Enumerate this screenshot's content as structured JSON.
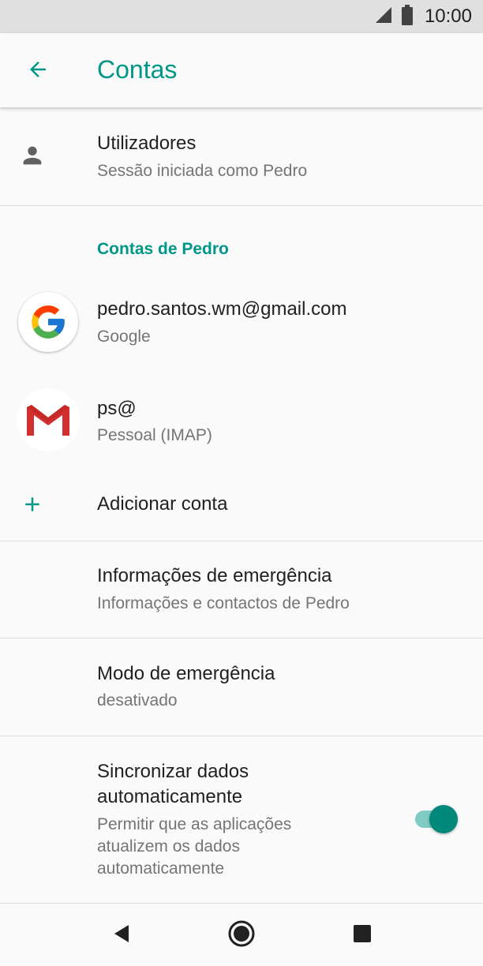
{
  "status_bar": {
    "time": "10:00",
    "icons": [
      "signal-icon",
      "battery-icon"
    ]
  },
  "app_bar": {
    "title": "Contas",
    "back_icon": "arrow-back-icon"
  },
  "users_row": {
    "title": "Utilizadores",
    "subtitle": "Sessão iniciada como Pedro",
    "icon": "person-icon"
  },
  "accounts_section": {
    "header": "Contas de Pedro",
    "accounts": [
      {
        "email": "pedro.santos.wm@gmail.com",
        "type": "Google",
        "icon": "google-icon"
      },
      {
        "email": "ps@",
        "type": "Pessoal (IMAP)",
        "icon": "gmail-icon"
      }
    ],
    "add_account_label": "Adicionar conta"
  },
  "emergency_info": {
    "title": "Informações de emergência",
    "subtitle": "Informações e contactos de Pedro"
  },
  "emergency_mode": {
    "title": "Modo de emergência",
    "subtitle": "desativado"
  },
  "auto_sync": {
    "title_line1": "Sincronizar dados",
    "title_line2": "automaticamente",
    "subtitle_line1": "Permitir que as aplicações",
    "subtitle_line2": "atualizem os dados",
    "subtitle_line3": "automaticamente",
    "enabled": true
  },
  "colors": {
    "accent": "#009688",
    "toggle_thumb": "#00897b",
    "toggle_track": "#80cbc4"
  },
  "nav_bar": {
    "icons": [
      "back-triangle-icon",
      "home-circle-icon",
      "recents-square-icon"
    ]
  }
}
